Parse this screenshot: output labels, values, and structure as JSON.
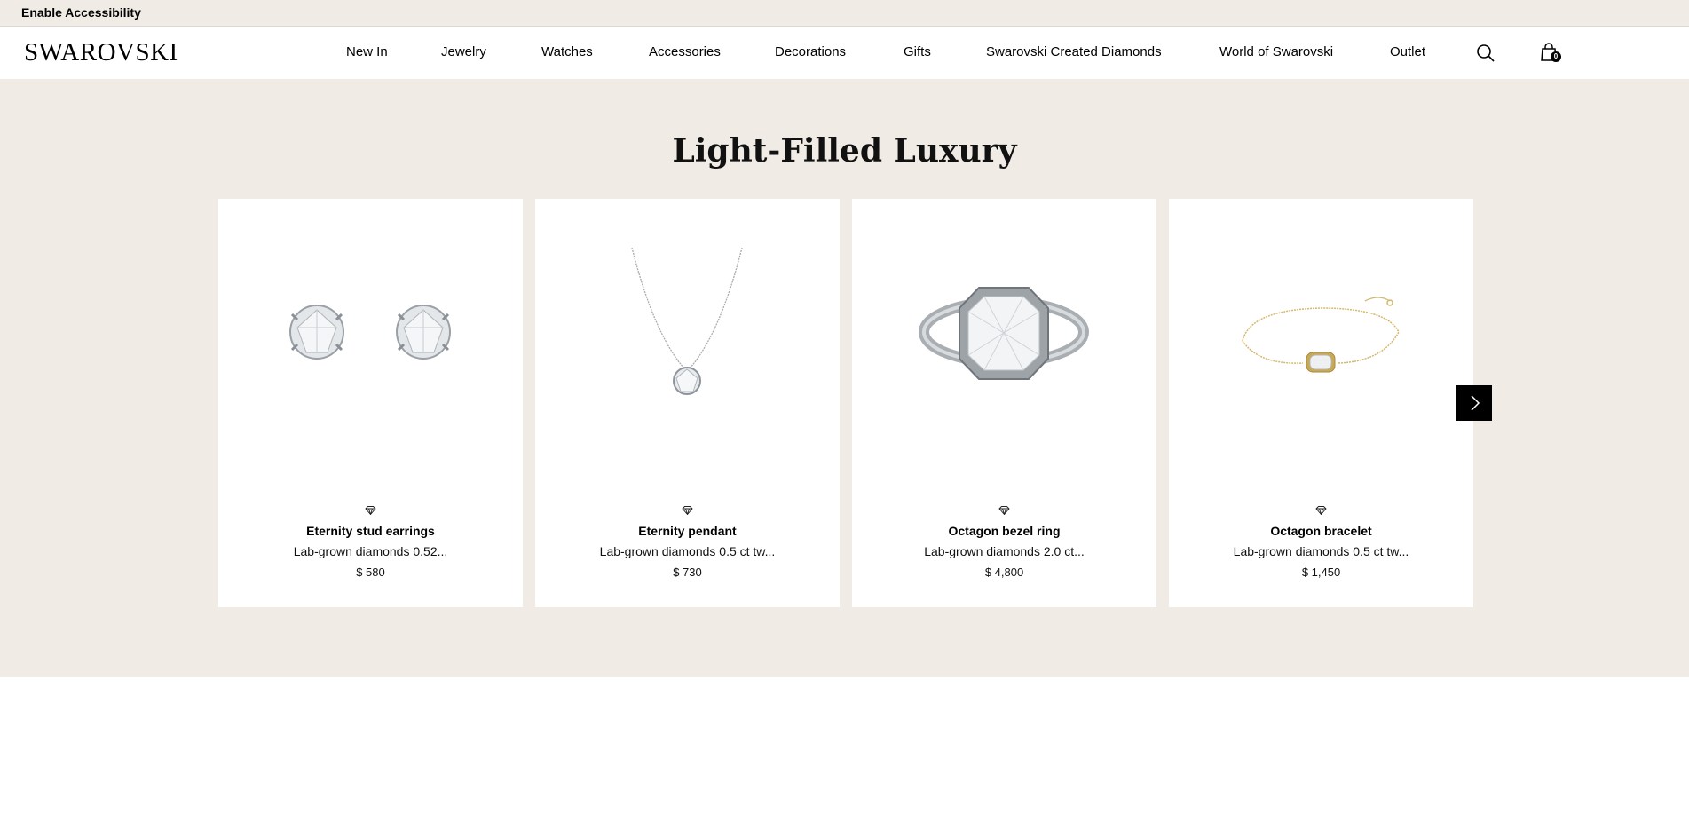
{
  "accessibility": {
    "label": "Enable Accessibility"
  },
  "header": {
    "logo": "SWAROVSKI",
    "nav": [
      {
        "label": "New In"
      },
      {
        "label": "Jewelry"
      },
      {
        "label": "Watches"
      },
      {
        "label": "Accessories"
      },
      {
        "label": "Decorations"
      },
      {
        "label": "Gifts"
      },
      {
        "label": "Swarovski Created Diamonds"
      },
      {
        "label": "World of Swarovski"
      },
      {
        "label": "Outlet"
      }
    ],
    "search_icon": "search-icon",
    "cart_icon": "shopping-bag-icon",
    "cart_count": "0"
  },
  "hero": {
    "title": "Light-Filled Luxury",
    "products": [
      {
        "name": "Eternity stud earrings",
        "desc": "Lab-grown diamonds 0.52...",
        "price": "$ 580"
      },
      {
        "name": "Eternity pendant",
        "desc": "Lab-grown diamonds 0.5 ct tw...",
        "price": "$ 730"
      },
      {
        "name": "Octagon bezel ring",
        "desc": "Lab-grown diamonds 2.0 ct...",
        "price": "$ 4,800"
      },
      {
        "name": "Octagon bracelet",
        "desc": "Lab-grown diamonds 0.5 ct tw...",
        "price": "$ 1,450"
      }
    ],
    "next_icon": "chevron-right-icon"
  },
  "colors": {
    "beige": "#f0ece5",
    "black": "#000000",
    "gold": "#d9c07a",
    "silver": "#b9bcc0"
  }
}
